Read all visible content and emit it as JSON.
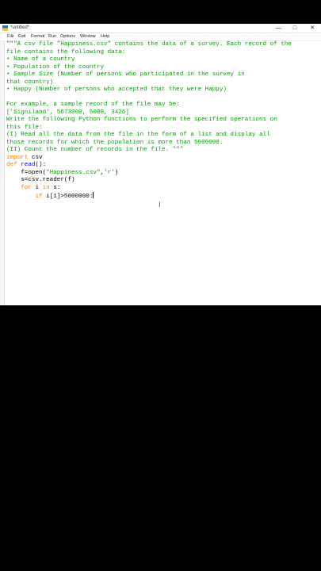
{
  "window": {
    "title": "*untitled*",
    "controls": {
      "minimize": "—",
      "maximize": "□",
      "close": "✕"
    }
  },
  "menubar": [
    "File",
    "Edit",
    "Format",
    "Run",
    "Options",
    "Window",
    "Help"
  ],
  "editor": {
    "docstring_lines": [
      "\"\"\"A csv file \"Happiness.csv\" contains the data of a survey. Each record of the",
      "file contains the following data:",
      "• Name of a country",
      "• Population of the country",
      "• Sample Size (Number of persons who participated in the survey in",
      "that country)",
      "• Happy (Number of persons who accepted that they were Happy)",
      "",
      "For example, a sample record of the file may be:",
      "['Signiland', 5673000, 5000, 3426]",
      "Write the following Python functions to perform the specified operations on",
      "this file:",
      "(I) Read all the data from the file in the form of a list and display all",
      "those records for which the population is more than 5000000.",
      "(II) Count the number of records in the file. \"\"\""
    ],
    "code": {
      "import_kw": "import",
      "import_mod": " csv",
      "def_kw": "def",
      "def_name": "read",
      "def_rest": "():",
      "open_pre": "    f=open(",
      "open_arg1": "\"Happiness.csv\"",
      "open_comma": ",",
      "open_arg2": "'r'",
      "open_post": ")",
      "reader_line": "    s=csv.reader(f)",
      "for_indent": "    ",
      "for_kw": "for",
      "for_mid": " i ",
      "in_kw": "in",
      "for_rest": " s:",
      "if_indent": "        ",
      "if_kw": "if",
      "if_rest": " i[1]>5000000:"
    }
  }
}
